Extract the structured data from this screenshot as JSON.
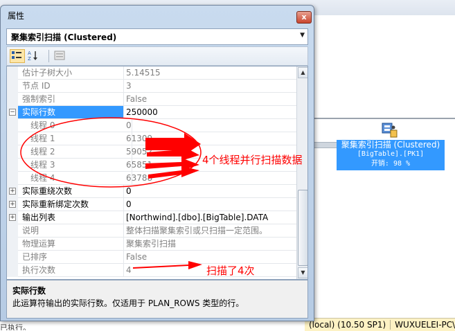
{
  "window": {
    "title": "属性",
    "close_glyph": "x",
    "object_select_value": "聚集索引扫描 (Clustered)"
  },
  "toolbar": {
    "icons": [
      "categorized-icon",
      "sort-alphabetical-icon",
      "property-pages-icon"
    ]
  },
  "properties": [
    {
      "name": "估计子树大小",
      "value": "5.14515"
    },
    {
      "name": "节点 ID",
      "value": "3"
    },
    {
      "name": "强制索引",
      "value": "False"
    },
    {
      "name": "实际行数",
      "value": "250000",
      "expander": "−"
    },
    {
      "name": "线程 0",
      "value": "0"
    },
    {
      "name": "线程 1",
      "value": "61309"
    },
    {
      "name": "线程 2",
      "value": "59052"
    },
    {
      "name": "线程 3",
      "value": "65851"
    },
    {
      "name": "线程 4",
      "value": "63788"
    },
    {
      "name": "实际重绕次数",
      "value": "0",
      "expander": "+"
    },
    {
      "name": "实际重新绑定次数",
      "value": "0",
      "expander": "+"
    },
    {
      "name": "输出列表",
      "value": "[Northwind].[dbo].[BigTable].DATA",
      "expander": "+"
    },
    {
      "name": "说明",
      "value": "整体扫描聚集索引或只扫描一定范围。"
    },
    {
      "name": "物理运算",
      "value": "聚集索引扫描"
    },
    {
      "name": "已排序",
      "value": "False"
    },
    {
      "name": "执行次数",
      "value": "4"
    }
  ],
  "description": {
    "title": "实际行数",
    "text": "此运算符输出的实际行数。仅适用于 PLAN_ROWS 类型的行。"
  },
  "plan_node": {
    "line1": "聚集索引扫描 (Clustered)",
    "line2": "[BigTable].[PK1]",
    "line3": "开销: 98 %"
  },
  "status_bar": {
    "server": "(local) (10.50 SP1)",
    "user": "WUXUELEI-PC\\"
  },
  "bg_left_status": "已执行。",
  "annotations": {
    "threads_note": "4个线程并行扫描数据",
    "scan_note": "扫描了4次"
  },
  "colors": {
    "selection": "#3399ff",
    "annotation": "#ff0000",
    "status_bar": "#fdf2c4"
  }
}
